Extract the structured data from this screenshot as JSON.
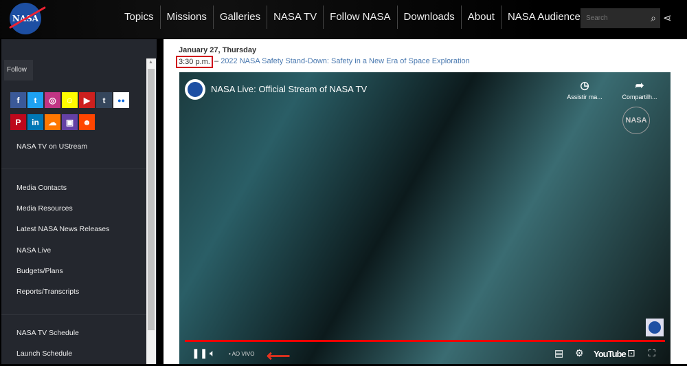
{
  "header": {
    "logo": "NASA",
    "nav": [
      "Topics",
      "Missions",
      "Galleries",
      "NASA TV",
      "Follow NASA",
      "Downloads",
      "About",
      "NASA Audiences"
    ],
    "search_placeholder": "Search",
    "search_icon": "search-icon",
    "share_icon": "share-icon"
  },
  "sidebar": {
    "follow_label": "Follow",
    "social_row1": [
      {
        "name": "facebook",
        "glyph": "f",
        "color": "#3b5998"
      },
      {
        "name": "twitter",
        "glyph": "t",
        "color": "#1da1f2"
      },
      {
        "name": "instagram",
        "glyph": "◎",
        "color": "#c13584"
      },
      {
        "name": "snapchat",
        "glyph": "☺",
        "color": "#fffc00"
      },
      {
        "name": "youtube",
        "glyph": "▶",
        "color": "#cd201f"
      },
      {
        "name": "tumblr",
        "glyph": "t",
        "color": "#35465c"
      },
      {
        "name": "flickr",
        "glyph": "●●",
        "color": "#ffffff"
      }
    ],
    "social_row2": [
      {
        "name": "pinterest",
        "glyph": "P",
        "color": "#bd081c"
      },
      {
        "name": "linkedin",
        "glyph": "in",
        "color": "#0077b5"
      },
      {
        "name": "soundcloud",
        "glyph": "☁",
        "color": "#ff7700"
      },
      {
        "name": "twitch",
        "glyph": "▣",
        "color": "#6441a5"
      },
      {
        "name": "reddit",
        "glyph": "☻",
        "color": "#ff4500"
      }
    ],
    "ustream": "NASA TV on UStream",
    "links": [
      "Media Contacts",
      "Media Resources",
      "Latest NASA News Releases",
      "NASA Live",
      "Budgets/Plans",
      "Reports/Transcripts"
    ],
    "links2": [
      "NASA TV Schedule",
      "Launch Schedule"
    ]
  },
  "main": {
    "date": "January 27, Thursday",
    "time": "3:30 p.m.",
    "dash": "–",
    "event": "2022 NASA Safety Stand-Down: Safety in a New Era of Space Exploration"
  },
  "video": {
    "title": "NASA Live: Official Stream of NASA TV",
    "watch_later": "Assistir ma...",
    "share": "Compartilh...",
    "watermark": "NASA",
    "live": "• AO VIVO",
    "youtube": "YouTube",
    "progress": 1.0
  }
}
